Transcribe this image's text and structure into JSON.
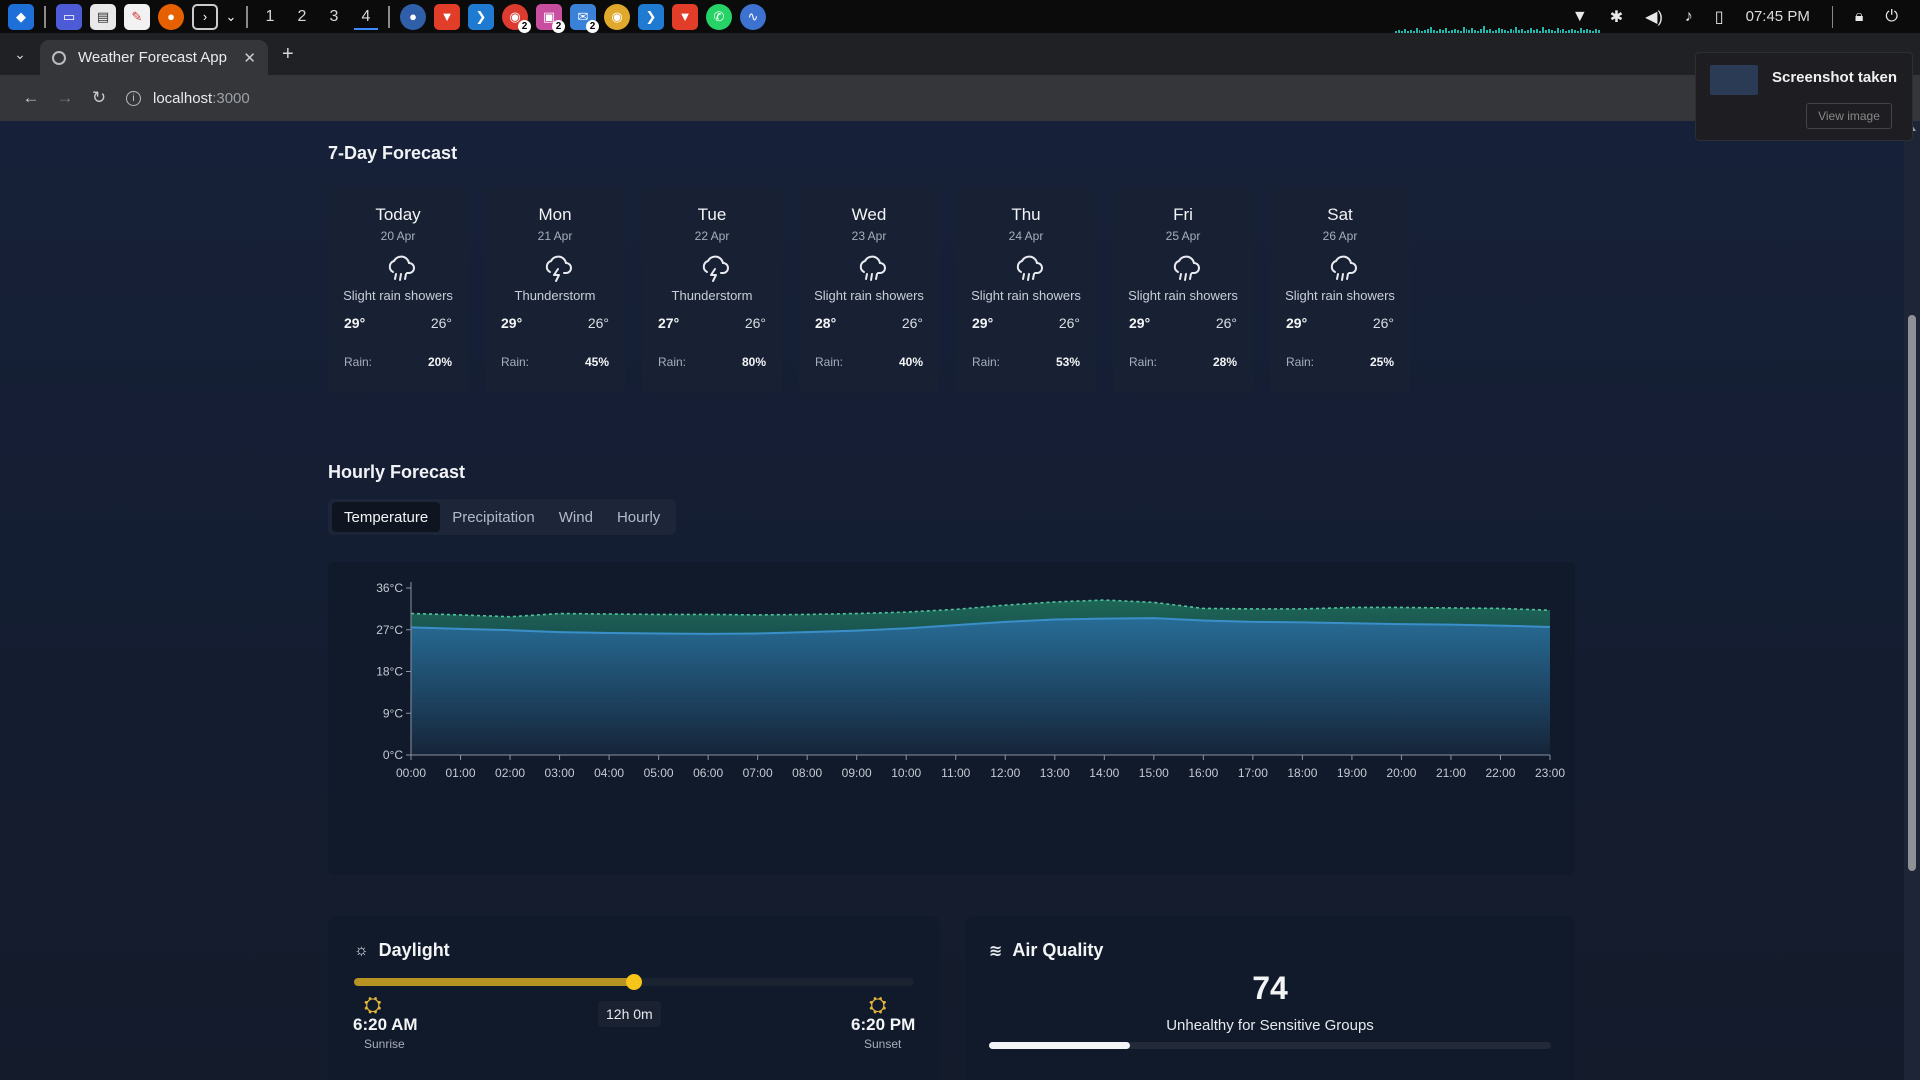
{
  "taskbar": {
    "workspaces": [
      "1",
      "2",
      "3",
      "4"
    ],
    "active_workspace": "4",
    "clock": "07:45 PM",
    "apps": [
      "launcher-icon",
      "desktop-icon",
      "files-icon",
      "text-editor-icon",
      "firefox-icon",
      "terminal-icon",
      "chevron-down-icon",
      "bitwarden-icon",
      "brave-icon",
      "vscode-icon",
      "chrome-icon",
      "image-viewer-icon",
      "mail-icon",
      "chrome-icon",
      "vscode-icon",
      "brave-icon",
      "whatsapp-icon",
      "activity-icon"
    ],
    "badges": [
      "2",
      "2",
      "2"
    ]
  },
  "browser": {
    "tab_title": "Weather Forecast App",
    "url_host": "localhost",
    "url_port": ":3000"
  },
  "notification": {
    "title": "Screenshot taken",
    "button": "View image"
  },
  "forecast": {
    "title": "7-Day Forecast",
    "rain_label": "Rain:",
    "days": [
      {
        "name": "Today",
        "date": "20 Apr",
        "condition": "Slight rain showers",
        "icon": "rain-cloud-icon",
        "high": "29°",
        "low": "26°",
        "rain": "20%"
      },
      {
        "name": "Mon",
        "date": "21 Apr",
        "condition": "Thunderstorm",
        "icon": "thunderstorm-icon",
        "high": "29°",
        "low": "26°",
        "rain": "45%"
      },
      {
        "name": "Tue",
        "date": "22 Apr",
        "condition": "Thunderstorm",
        "icon": "thunderstorm-icon",
        "high": "27°",
        "low": "26°",
        "rain": "80%"
      },
      {
        "name": "Wed",
        "date": "23 Apr",
        "condition": "Slight rain showers",
        "icon": "rain-cloud-icon",
        "high": "28°",
        "low": "26°",
        "rain": "40%"
      },
      {
        "name": "Thu",
        "date": "24 Apr",
        "condition": "Slight rain showers",
        "icon": "rain-cloud-icon",
        "high": "29°",
        "low": "26°",
        "rain": "53%"
      },
      {
        "name": "Fri",
        "date": "25 Apr",
        "condition": "Slight rain showers",
        "icon": "rain-cloud-icon",
        "high": "29°",
        "low": "26°",
        "rain": "28%"
      },
      {
        "name": "Sat",
        "date": "26 Apr",
        "condition": "Slight rain showers",
        "icon": "rain-cloud-icon",
        "high": "29°",
        "low": "26°",
        "rain": "25%"
      }
    ]
  },
  "hourly": {
    "title": "Hourly Forecast",
    "tabs": [
      "Temperature",
      "Precipitation",
      "Wind",
      "Hourly"
    ],
    "active_tab": "Temperature"
  },
  "chart_data": {
    "type": "area",
    "title": "",
    "xlabel": "",
    "ylabel": "",
    "categories": [
      "00:00",
      "01:00",
      "02:00",
      "03:00",
      "04:00",
      "05:00",
      "06:00",
      "07:00",
      "08:00",
      "09:00",
      "10:00",
      "11:00",
      "12:00",
      "13:00",
      "14:00",
      "15:00",
      "16:00",
      "17:00",
      "18:00",
      "19:00",
      "20:00",
      "21:00",
      "22:00",
      "23:00"
    ],
    "y_ticks": [
      "0°C",
      "9°C",
      "18°C",
      "27°C",
      "36°C"
    ],
    "ylim": [
      0,
      36
    ],
    "grid": false,
    "series": [
      {
        "values": [
          27.5,
          27.2,
          26.9,
          26.5,
          26.3,
          26.2,
          26.1,
          26.2,
          26.5,
          26.8,
          27.3,
          28.0,
          28.7,
          29.2,
          29.4,
          29.5,
          29.0,
          28.7,
          28.6,
          28.4,
          28.2,
          28.1,
          27.9,
          27.6
        ],
        "color": "#3b8fc9"
      },
      {
        "values": [
          30.5,
          30.2,
          29.8,
          30.5,
          30.4,
          30.3,
          30.3,
          30.2,
          30.3,
          30.5,
          30.8,
          31.4,
          32.3,
          33.0,
          33.4,
          32.9,
          31.6,
          31.5,
          31.5,
          31.8,
          31.8,
          31.7,
          31.6,
          31.2
        ],
        "color": "#1f8a6d",
        "style": "dashed"
      }
    ]
  },
  "daylight": {
    "title": "Daylight",
    "progress": 0.5,
    "length": "12h 0m",
    "sunrise_time": "6:20 AM",
    "sunrise_label": "Sunrise",
    "sunset_time": "6:20 PM",
    "sunset_label": "Sunset"
  },
  "air_quality": {
    "title": "Air Quality",
    "value": "74",
    "status": "Unhealthy for Sensitive Groups",
    "level": 0.25
  }
}
